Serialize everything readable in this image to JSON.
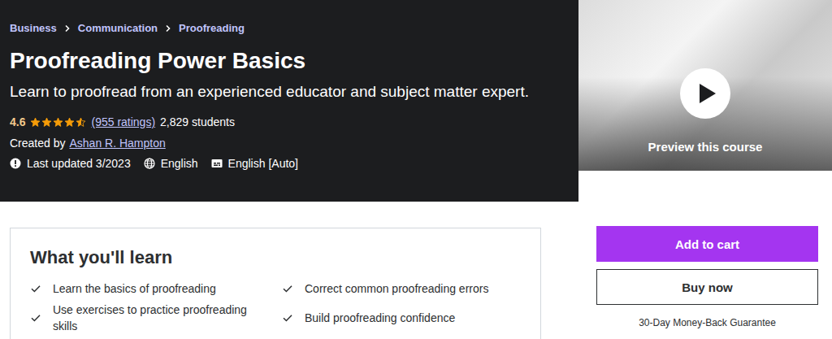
{
  "breadcrumb": [
    {
      "label": "Business"
    },
    {
      "label": "Communication"
    },
    {
      "label": "Proofreading"
    }
  ],
  "course": {
    "title": "Proofreading Power Basics",
    "subtitle": "Learn to proofread from an experienced educator and subject matter expert.",
    "rating": "4.6",
    "stars": 4.5,
    "ratings_count": "(955 ratings)",
    "students": "2,829 students",
    "created_by_label": "Created by",
    "instructor": "Ashan R. Hampton",
    "last_updated": "Last updated 3/2023",
    "language": "English",
    "captions": "English [Auto]"
  },
  "preview": {
    "label": "Preview this course"
  },
  "learn": {
    "title": "What you'll learn",
    "items": [
      "Learn the basics of proofreading",
      "Correct common proofreading errors",
      "Use exercises to practice proofreading skills",
      "Build proofreading confidence"
    ]
  },
  "purchase": {
    "add_to_cart": "Add to cart",
    "buy_now": "Buy now",
    "guarantee": "30-Day Money-Back Guarantee"
  }
}
